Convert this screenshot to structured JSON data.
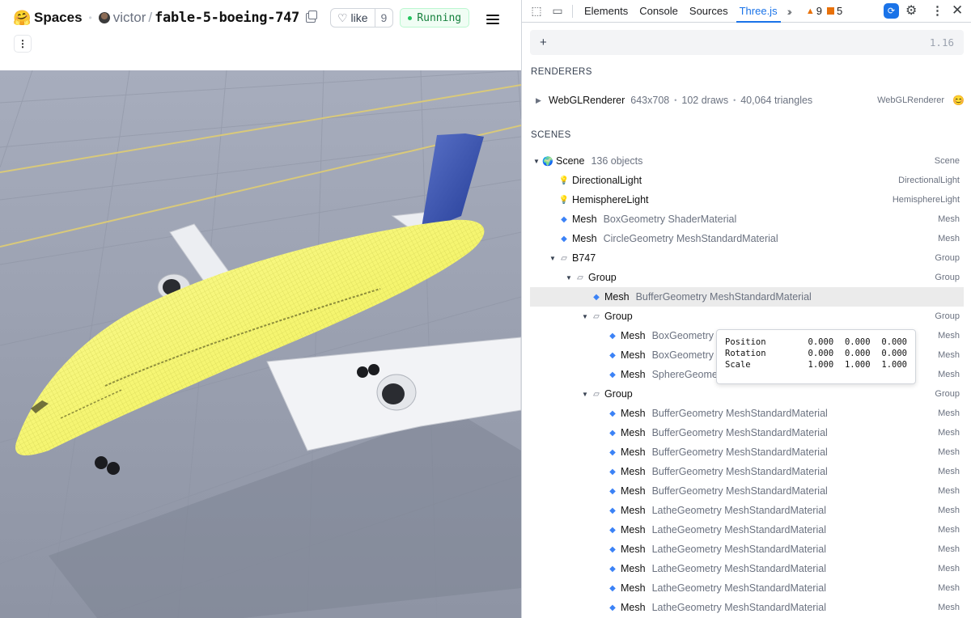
{
  "space": {
    "brand": "Spaces",
    "owner": "victor",
    "repo": "fable-5-boeing-747",
    "like_label": "like",
    "like_count": "9",
    "status": "Running"
  },
  "devtools": {
    "tabs": [
      "Elements",
      "Console",
      "Sources",
      "Three.js"
    ],
    "active_tab": "Three.js",
    "warnings": "9",
    "errors": "5"
  },
  "threejs": {
    "search_plus": "+",
    "version": "1.16",
    "renderers_title": "RENDERERS",
    "renderer": {
      "name": "WebGLRenderer",
      "size": "643x708",
      "draws": "102 draws",
      "triangles": "40,064 triangles",
      "type": "WebGLRenderer"
    },
    "scenes_title": "SCENES",
    "tree": [
      {
        "name": "Scene",
        "sub": "136 objects",
        "type": "Scene",
        "icon": "globe-icon",
        "kind": "scene",
        "depth": 0,
        "arrow": "▼"
      },
      {
        "name": "DirectionalLight",
        "sub": "",
        "type": "DirectionalLight",
        "icon": "bulb-icon",
        "kind": "light",
        "depth": 1,
        "arrow": ""
      },
      {
        "name": "HemisphereLight",
        "sub": "",
        "type": "HemisphereLight",
        "icon": "bulb-icon",
        "kind": "light",
        "depth": 1,
        "arrow": ""
      },
      {
        "name": "Mesh",
        "sub": "BoxGeometry ShaderMaterial",
        "type": "Mesh",
        "icon": "diamond-icon",
        "kind": "mesh",
        "depth": 1,
        "arrow": ""
      },
      {
        "name": "Mesh",
        "sub": "CircleGeometry MeshStandardMaterial",
        "type": "Mesh",
        "icon": "diamond-icon",
        "kind": "mesh",
        "depth": 1,
        "arrow": ""
      },
      {
        "name": "B747",
        "sub": "",
        "type": "Group",
        "icon": "folder-icon",
        "kind": "group",
        "depth": 1,
        "arrow": "▼"
      },
      {
        "name": "Group",
        "sub": "",
        "type": "Group",
        "icon": "folder-icon",
        "kind": "group",
        "depth": 2,
        "arrow": "▼"
      },
      {
        "name": "Mesh",
        "sub": "BufferGeometry MeshStandardMaterial",
        "type": "",
        "icon": "diamond-icon",
        "kind": "mesh",
        "depth": 3,
        "arrow": "",
        "selected": true
      },
      {
        "name": "Group",
        "sub": "",
        "type": "Group",
        "icon": "folder-icon",
        "kind": "group",
        "depth": 3,
        "arrow": "▼"
      },
      {
        "name": "Mesh",
        "sub": "BoxGeometry",
        "type": "Mesh",
        "icon": "diamond-icon",
        "kind": "mesh",
        "depth": 4,
        "arrow": ""
      },
      {
        "name": "Mesh",
        "sub": "BoxGeometry",
        "type": "Mesh",
        "icon": "diamond-icon",
        "kind": "mesh",
        "depth": 4,
        "arrow": ""
      },
      {
        "name": "Mesh",
        "sub": "SphereGeometry MeshStandardMaterial",
        "type": "Mesh",
        "icon": "diamond-icon",
        "kind": "mesh",
        "depth": 4,
        "arrow": ""
      },
      {
        "name": "Group",
        "sub": "",
        "type": "Group",
        "icon": "folder-icon",
        "kind": "group",
        "depth": 3,
        "arrow": "▼"
      },
      {
        "name": "Mesh",
        "sub": "BufferGeometry MeshStandardMaterial",
        "type": "Mesh",
        "icon": "diamond-icon",
        "kind": "mesh",
        "depth": 4,
        "arrow": ""
      },
      {
        "name": "Mesh",
        "sub": "BufferGeometry MeshStandardMaterial",
        "type": "Mesh",
        "icon": "diamond-icon",
        "kind": "mesh",
        "depth": 4,
        "arrow": ""
      },
      {
        "name": "Mesh",
        "sub": "BufferGeometry MeshStandardMaterial",
        "type": "Mesh",
        "icon": "diamond-icon",
        "kind": "mesh",
        "depth": 4,
        "arrow": ""
      },
      {
        "name": "Mesh",
        "sub": "BufferGeometry MeshStandardMaterial",
        "type": "Mesh",
        "icon": "diamond-icon",
        "kind": "mesh",
        "depth": 4,
        "arrow": ""
      },
      {
        "name": "Mesh",
        "sub": "BufferGeometry MeshStandardMaterial",
        "type": "Mesh",
        "icon": "diamond-icon",
        "kind": "mesh",
        "depth": 4,
        "arrow": ""
      },
      {
        "name": "Mesh",
        "sub": "LatheGeometry MeshStandardMaterial",
        "type": "Mesh",
        "icon": "diamond-icon",
        "kind": "mesh",
        "depth": 4,
        "arrow": ""
      },
      {
        "name": "Mesh",
        "sub": "LatheGeometry MeshStandardMaterial",
        "type": "Mesh",
        "icon": "diamond-icon",
        "kind": "mesh",
        "depth": 4,
        "arrow": ""
      },
      {
        "name": "Mesh",
        "sub": "LatheGeometry MeshStandardMaterial",
        "type": "Mesh",
        "icon": "diamond-icon",
        "kind": "mesh",
        "depth": 4,
        "arrow": ""
      },
      {
        "name": "Mesh",
        "sub": "LatheGeometry MeshStandardMaterial",
        "type": "Mesh",
        "icon": "diamond-icon",
        "kind": "mesh",
        "depth": 4,
        "arrow": ""
      },
      {
        "name": "Mesh",
        "sub": "LatheGeometry MeshStandardMaterial",
        "type": "Mesh",
        "icon": "diamond-icon",
        "kind": "mesh",
        "depth": 4,
        "arrow": ""
      },
      {
        "name": "Mesh",
        "sub": "LatheGeometry MeshStandardMaterial",
        "type": "Mesh",
        "icon": "diamond-icon",
        "kind": "mesh",
        "depth": 4,
        "arrow": ""
      }
    ],
    "tooltip": {
      "rows": [
        {
          "label": "Position",
          "values": [
            "0.000",
            "0.000",
            "0.000"
          ]
        },
        {
          "label": "Rotation",
          "values": [
            "0.000",
            "0.000",
            "0.000"
          ]
        },
        {
          "label": "Scale",
          "values": [
            "1.000",
            "1.000",
            "1.000"
          ]
        }
      ]
    }
  },
  "colors": {
    "accent": "#1a73e8",
    "running_green": "#15803d",
    "wireframe_yellow": "#f7f76a",
    "tail_blue": "#2f4aa8"
  }
}
